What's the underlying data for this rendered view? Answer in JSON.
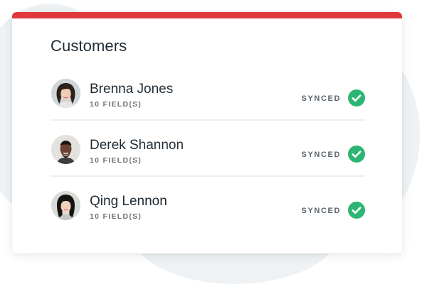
{
  "card": {
    "title": "Customers",
    "accent_color": "#e0393b"
  },
  "customers": [
    {
      "name": "Brenna Jones",
      "fields": "10 FIELD(S)",
      "status": "SYNCED",
      "status_icon": "check-circle-icon",
      "avatar": "avatar-photo"
    },
    {
      "name": "Derek Shannon",
      "fields": "10 FIELD(S)",
      "status": "SYNCED",
      "status_icon": "check-circle-icon",
      "avatar": "avatar-photo"
    },
    {
      "name": "Qing Lennon",
      "fields": "10 FIELD(S)",
      "status": "SYNCED",
      "status_icon": "check-circle-icon",
      "avatar": "avatar-photo"
    }
  ],
  "colors": {
    "synced_green": "#2bb673",
    "background_blob": "#eef2f4"
  }
}
